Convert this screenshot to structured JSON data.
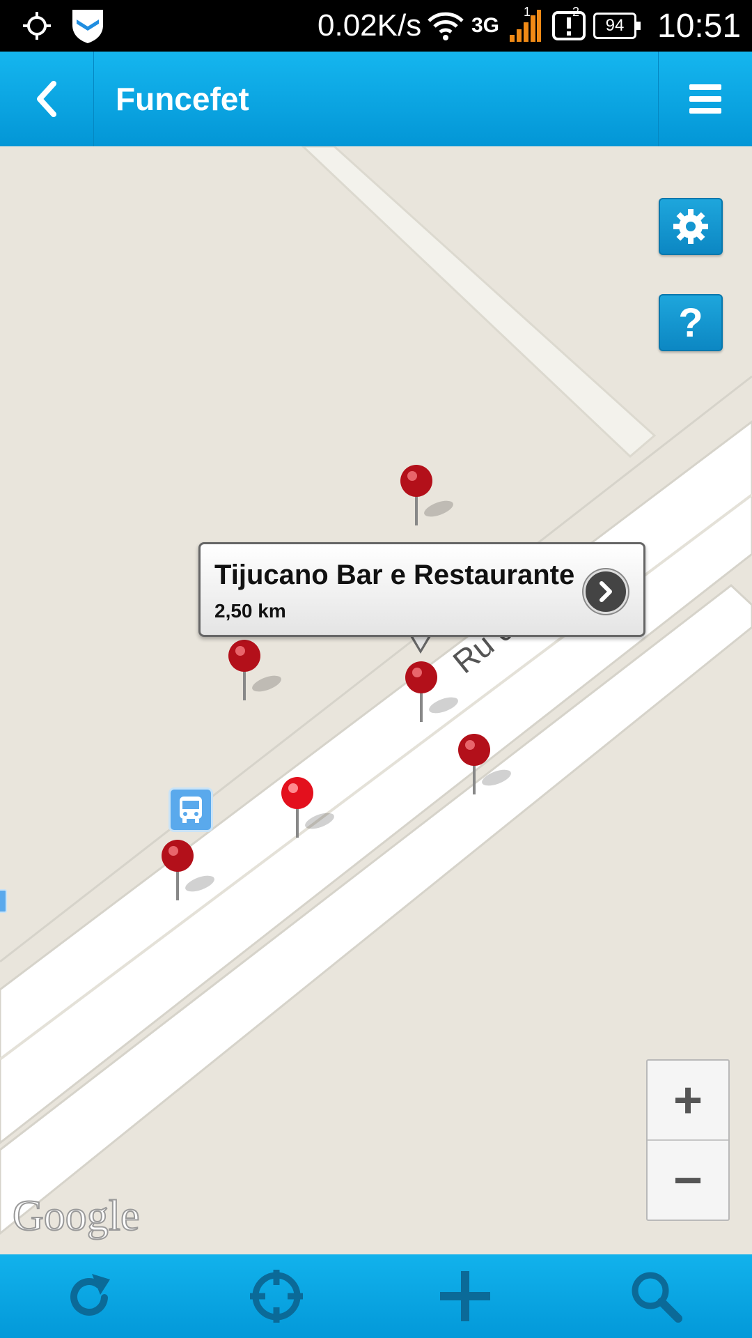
{
  "status_bar": {
    "net_speed": "0.02K/s",
    "network_type": "3G",
    "sim_slot": "1",
    "notification_count": "2",
    "battery": "94",
    "time": "10:51",
    "icons": [
      "location-icon",
      "shield-app-icon",
      "wifi-icon",
      "signal-icon",
      "alert-icon",
      "battery-icon"
    ]
  },
  "app_bar": {
    "title": "Funcefet",
    "back_icon": "chevron-left-icon",
    "menu_icon": "hamburger-menu-icon",
    "color": "#0aa6e4"
  },
  "map": {
    "street_label": "Ru          de Bonfim",
    "attribution": "Google",
    "buttons": [
      "settings-button",
      "help-button"
    ],
    "help_label": "?",
    "callout": {
      "name": "Tijucano Bar e Restaurante",
      "distance": "2,50 km"
    },
    "zoom": {
      "in": "+",
      "out": "−"
    },
    "pin_color": "#c0101a"
  },
  "toolbar": {
    "items": [
      "refresh-icon",
      "locate-icon",
      "add-icon",
      "search-icon"
    ]
  }
}
